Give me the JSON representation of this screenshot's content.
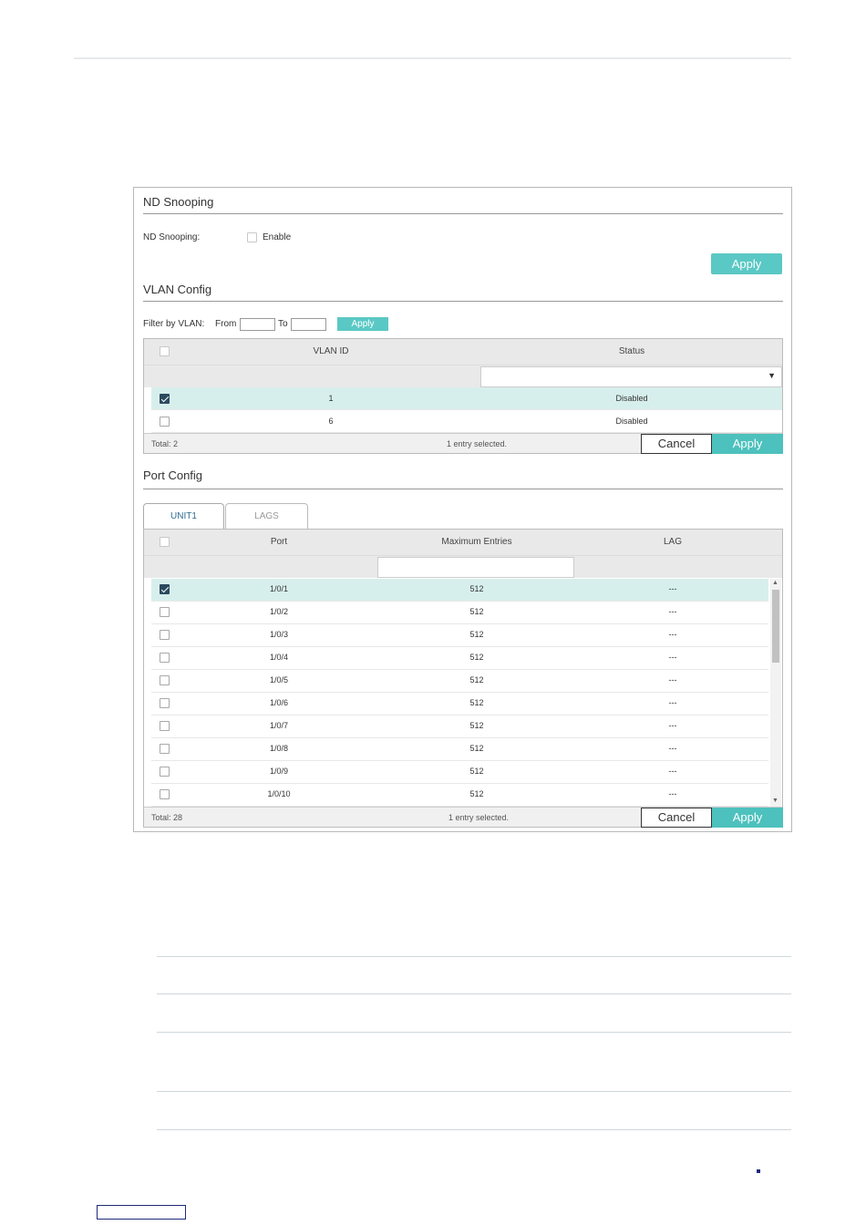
{
  "nd_snooping": {
    "title": "ND Snooping",
    "field_label": "ND Snooping:",
    "enable_label": "Enable",
    "enable_checked": false,
    "apply_label": "Apply"
  },
  "vlan_config": {
    "title": "VLAN Config",
    "filter_label": "Filter by VLAN:",
    "from_label": "From",
    "to_label": "To",
    "from_value": "",
    "to_value": "",
    "filter_apply_label": "Apply",
    "columns": [
      "VLAN ID",
      "Status"
    ],
    "rows": [
      {
        "vlan_id": "1",
        "status": "Disabled",
        "selected": true
      },
      {
        "vlan_id": "6",
        "status": "Disabled",
        "selected": false
      }
    ],
    "total": "Total: 2",
    "selection_text": "1 entry selected.",
    "cancel_label": "Cancel",
    "apply_label": "Apply"
  },
  "port_config": {
    "title": "Port Config",
    "tabs": [
      "UNIT1",
      "LAGS"
    ],
    "active_tab": "UNIT1",
    "columns": [
      "Port",
      "Maximum Entries",
      "LAG"
    ],
    "rows": [
      {
        "port": "1/0/1",
        "max": "512",
        "lag": "---",
        "selected": true
      },
      {
        "port": "1/0/2",
        "max": "512",
        "lag": "---",
        "selected": false
      },
      {
        "port": "1/0/3",
        "max": "512",
        "lag": "---",
        "selected": false
      },
      {
        "port": "1/0/4",
        "max": "512",
        "lag": "---",
        "selected": false
      },
      {
        "port": "1/0/5",
        "max": "512",
        "lag": "---",
        "selected": false
      },
      {
        "port": "1/0/6",
        "max": "512",
        "lag": "---",
        "selected": false
      },
      {
        "port": "1/0/7",
        "max": "512",
        "lag": "---",
        "selected": false
      },
      {
        "port": "1/0/8",
        "max": "512",
        "lag": "---",
        "selected": false
      },
      {
        "port": "1/0/9",
        "max": "512",
        "lag": "---",
        "selected": false
      },
      {
        "port": "1/0/10",
        "max": "512",
        "lag": "---",
        "selected": false
      }
    ],
    "total": "Total: 28",
    "selection_text": "1 entry selected.",
    "cancel_label": "Cancel",
    "apply_label": "Apply"
  },
  "icons": {
    "dropdown": "caret-down-icon",
    "scroll_up": "scroll-up-icon",
    "scroll_down": "scroll-down-icon"
  },
  "colors": {
    "accent": "#5ac8c4",
    "selected_row": "#d7efec",
    "checkbox_checked": "#2b4a5e"
  }
}
